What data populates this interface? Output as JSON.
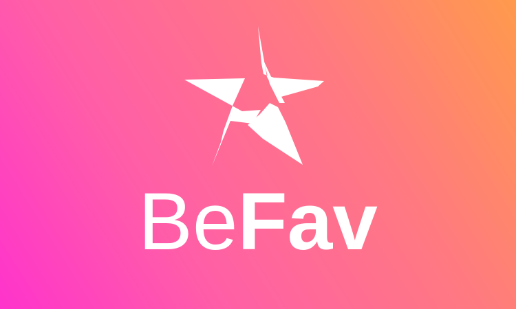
{
  "brand": {
    "name_part_1": "Be",
    "name_part_2": "Fav",
    "logo_icon": "star-icon",
    "colors": {
      "gradient_start": "#ff33cc",
      "gradient_mid": "#ff7a80",
      "gradient_end": "#ff9a4c",
      "foreground": "#ffffff"
    }
  }
}
